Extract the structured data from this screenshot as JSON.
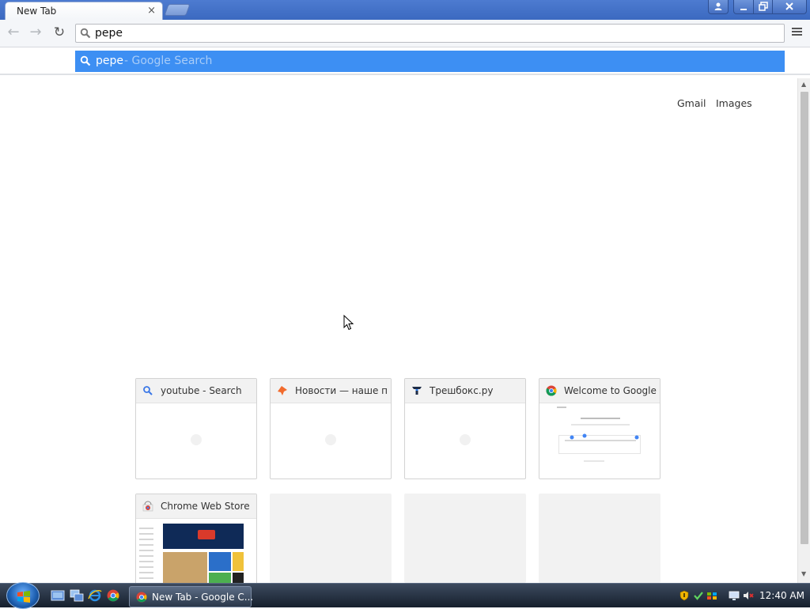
{
  "window": {
    "tab_title": "New Tab",
    "tab_close": "×"
  },
  "toolbar": {
    "back_icon": "←",
    "forward_icon": "→",
    "reload_icon": "↻",
    "omnibox_value": "pepe"
  },
  "suggestion": {
    "query": "pepe",
    "suffix": "- Google Search"
  },
  "page": {
    "links": [
      "Gmail",
      "Images"
    ]
  },
  "tiles": [
    {
      "title": "youtube - Search",
      "favicon": "search-icon"
    },
    {
      "title": "Новости — наше пр",
      "favicon": "pin-icon"
    },
    {
      "title": "Трешбокс.ру",
      "favicon": "t-logo-icon"
    },
    {
      "title": "Welcome to Google C",
      "favicon": "chrome-icon"
    },
    {
      "title": "Chrome Web Store",
      "favicon": "webstore-icon"
    }
  ],
  "taskbar": {
    "task_label": "New Tab - Google C...",
    "clock": "12:40 AM"
  },
  "colors": {
    "selection": "#3d8ff3",
    "titlebar": "#4d7bd0"
  }
}
